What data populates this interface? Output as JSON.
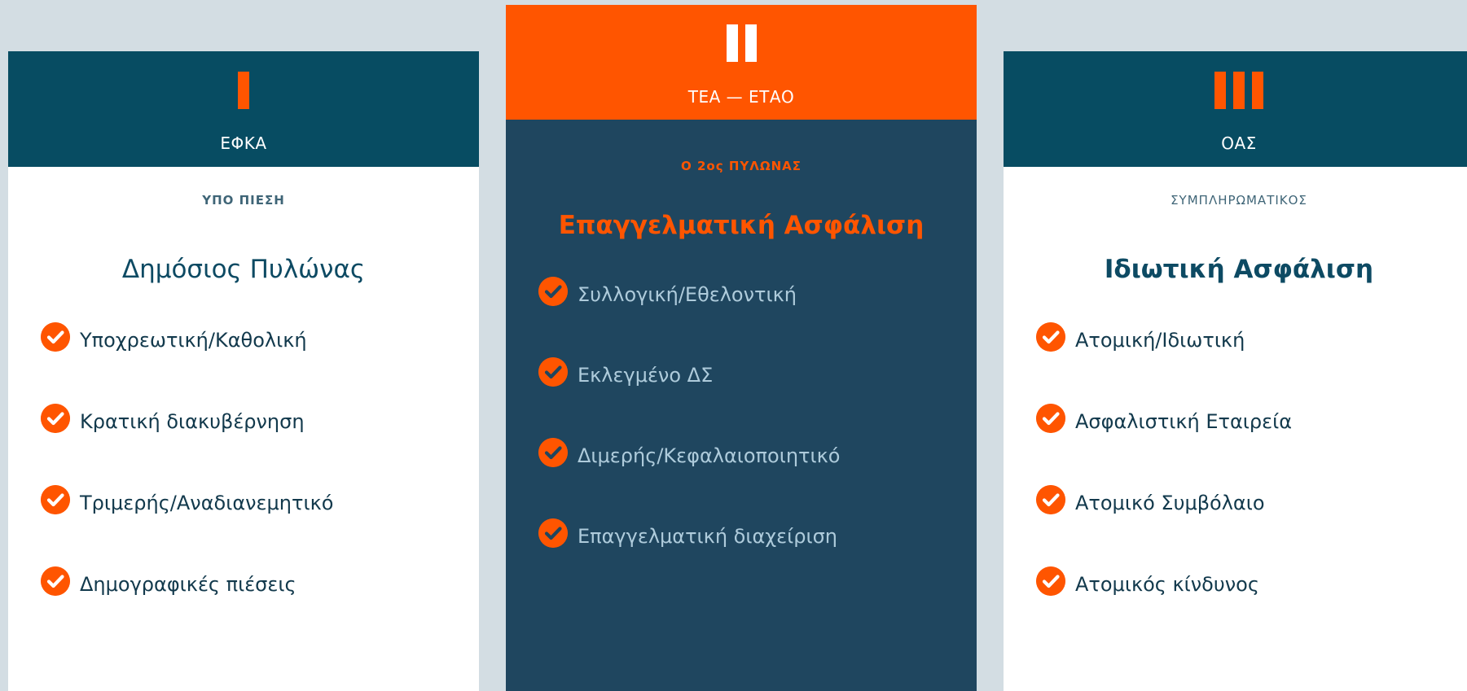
{
  "pillars": [
    {
      "header_label": "ΕΦΚΑ",
      "kicker": "ΥΠΟ ΠΙΕΣΗ",
      "title": "Δημόσιος Πυλώνας",
      "features": [
        "Υποχρεωτική/Καθολική",
        "Κρατική διακυβέρνηση",
        "Τριμερής/Αναδιανεμητικό",
        "Δημογραφικές πιέσεις"
      ]
    },
    {
      "header_label": "ΤΕΑ — ΕΤΑΟ",
      "kicker": "Ο 2ος ΠΥΛΩΝΑΣ",
      "title": "Επαγγελματική Ασφάλιση",
      "features": [
        "Συλλογική/Εθελοντική",
        "Εκλεγμένο ΔΣ",
        "Διμερής/Κεφαλαιοποιητικό",
        "Επαγγελματική διαχείριση"
      ]
    },
    {
      "header_label": "ΟΑΣ",
      "kicker": "ΣΥΜΠΛΗΡΩΜΑΤΙΚΟΣ",
      "title": "Ιδιωτική Ασφάλιση",
      "features": [
        "Ατομική/Ιδιωτική",
        "Ασφαλιστική Εταιρεία",
        "Ατομικό Συμβόλαιο",
        "Ατομικός κίνδυνος"
      ]
    }
  ],
  "colors": {
    "page_background": "#d3dde3",
    "accent_orange": "#ff5500",
    "header_teal": "#074c62",
    "featured_card_navy": "#1f465f"
  },
  "icons": {
    "pillar_numeral": "roman-numeral-bars",
    "feature_bullet": "check-circle-icon"
  }
}
